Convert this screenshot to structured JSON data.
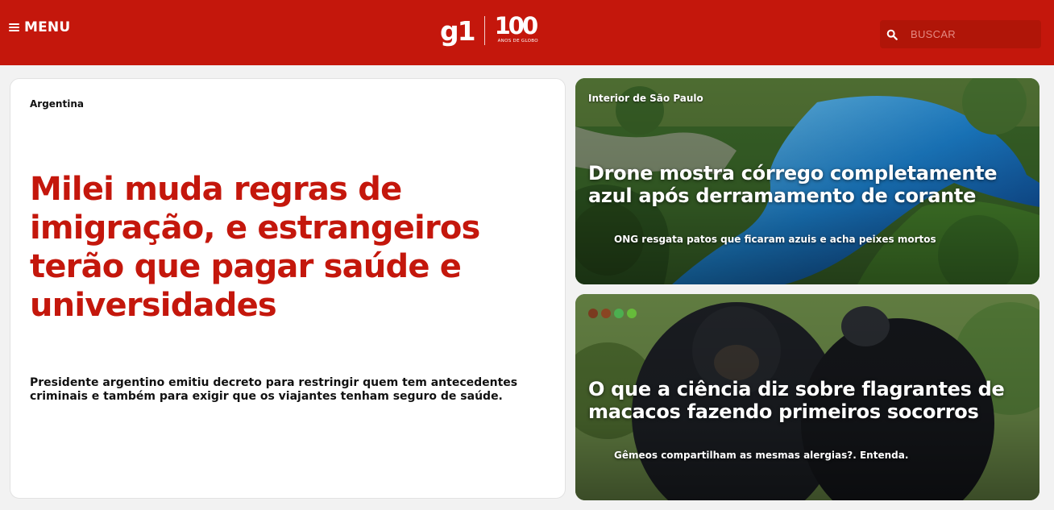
{
  "header": {
    "menu_label": "MENU",
    "logo_text": "g1",
    "badge_number": "100",
    "badge_sub": "ANOS DE GLOBO",
    "search_placeholder": "BUSCAR",
    "brand_color": "#c4170c"
  },
  "main_story": {
    "chapeu": "Argentina",
    "headline": "Milei muda regras de imigração, e estrangeiros terão que pagar saúde e universidades",
    "summary": "Presidente argentino emitiu decreto para restringir quem tem antecedentes criminais e também para exigir que os viajantes tenham seguro de saúde."
  },
  "side_stories": [
    {
      "chapeu": "Interior de São Paulo",
      "title": "Drone mostra córrego completamente azul após derramamento de corante",
      "related": "ONG resgata patos que ficaram azuis e acha peixes mortos"
    },
    {
      "chapeu_icons": [
        "monkey-icon",
        "monkey-icon",
        "leaf-icon",
        "leaf-icon"
      ],
      "title": "O que a ciência diz sobre flagrantes de macacos fazendo primeiros socorros",
      "related": "Gêmeos compartilham as mesmas alergias?. Entenda."
    }
  ]
}
